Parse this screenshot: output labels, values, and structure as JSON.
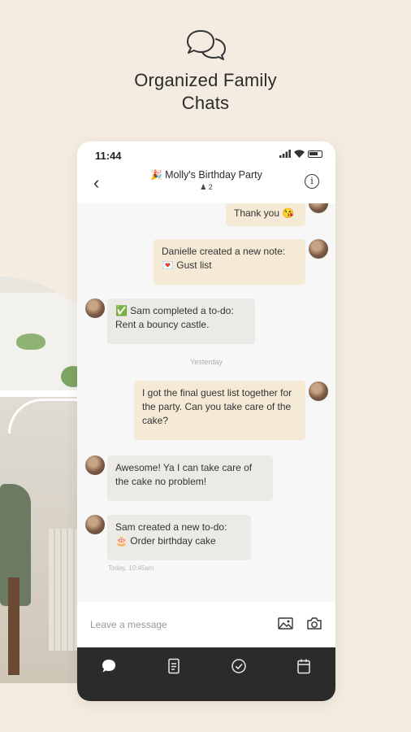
{
  "headline": {
    "line1": "Organized Family",
    "line2": "Chats"
  },
  "status": {
    "time": "11:44"
  },
  "chat": {
    "emoji": "🎉",
    "title": "Molly's Birthday Party",
    "members_icon": "person-icon",
    "member_count": "2"
  },
  "messages": [
    {
      "side": "out",
      "text": "Thank you 😘"
    },
    {
      "side": "out",
      "text": "Danielle created a new note:",
      "sub": "💌 Gust list"
    },
    {
      "side": "in",
      "text": "✅ Sam completed a to-do:",
      "sub": "Rent a bouncy castle."
    },
    {
      "side": "out",
      "text": "I got the final guest list together for the party. Can you take care of the cake?"
    },
    {
      "side": "in",
      "text": "Awesome! Ya I can take care of the cake no problem!"
    },
    {
      "side": "in",
      "text": "Sam created a new to-do:",
      "sub": "🎂 Order birthday cake"
    }
  ],
  "day_divider": "Yesterday",
  "timestamp": "Today, 10:45am",
  "composer": {
    "placeholder": "Leave a message",
    "icons": [
      "image-icon",
      "camera-icon"
    ]
  },
  "tabs": [
    "chat-icon",
    "notes-icon",
    "todo-icon",
    "calendar-icon"
  ],
  "colors": {
    "background": "#f4ece0",
    "outgoing_bubble": "#f5ead6",
    "incoming_bubble": "#eceae7",
    "tabbar": "#2b2b2b"
  }
}
